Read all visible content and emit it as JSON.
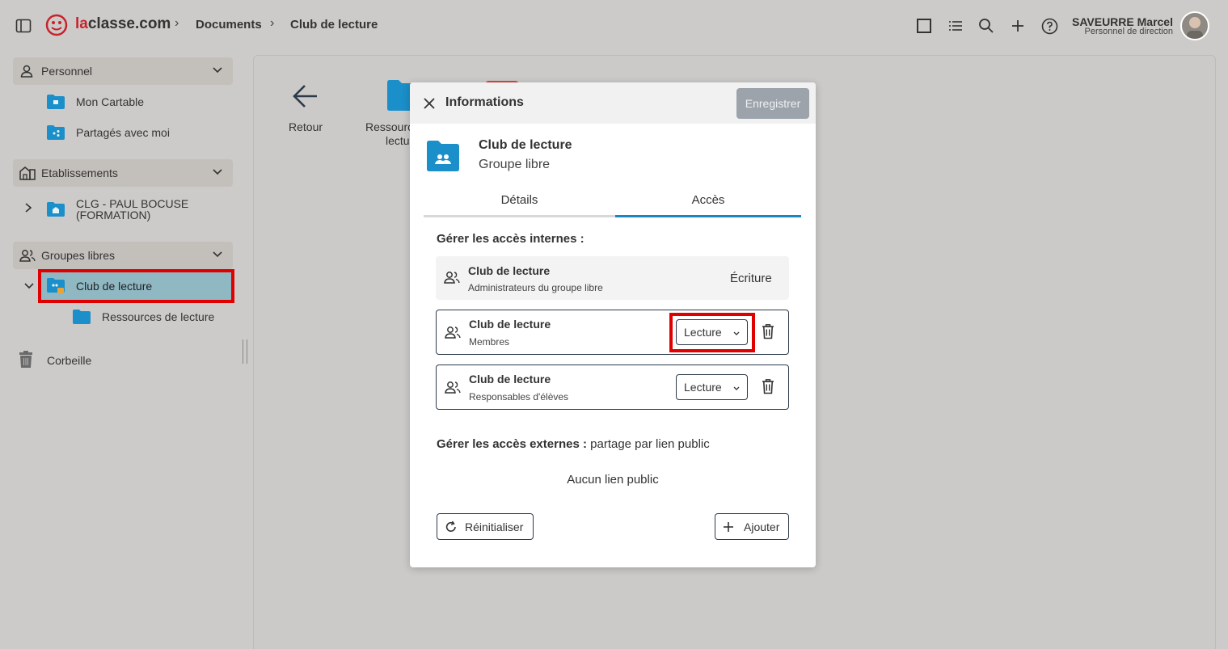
{
  "topbar": {
    "logo_text": "laclasse.com",
    "breadcrumb": [
      "Documents",
      "Club de lecture"
    ],
    "user_name": "SAVEURRE Marcel",
    "user_role": "Personnel de direction"
  },
  "sidebar": {
    "personnel": {
      "label": "Personnel",
      "items": [
        "Mon Cartable",
        "Partagés avec moi"
      ]
    },
    "etablissements": {
      "label": "Etablissements",
      "items": [
        "CLG - PAUL BOCUSE (FORMATION)"
      ]
    },
    "groupes": {
      "label": "Groupes libres",
      "selected": "Club de lecture",
      "child": "Ressources de lecture"
    },
    "trash_label": "Corbeille"
  },
  "content": {
    "back_label": "Retour",
    "folder_label_1": "Ressources",
    "folder_label_2": "lecture"
  },
  "modal": {
    "title": "Informations",
    "save_label": "Enregistrer",
    "item_name": "Club de lecture",
    "item_type": "Groupe libre",
    "tabs": [
      "Détails",
      "Accès"
    ],
    "active_tab": "Accès",
    "internal_heading": "Gérer les accès internes :",
    "rows": [
      {
        "title": "Club de lecture",
        "subtitle": "Administrateurs du groupe libre",
        "access": "Écriture"
      },
      {
        "title": "Club de lecture",
        "subtitle": "Membres",
        "access": "Lecture"
      },
      {
        "title": "Club de lecture",
        "subtitle": "Responsables d'élèves",
        "access": "Lecture"
      }
    ],
    "external_heading_bold": "Gérer les accès externes :",
    "external_heading_rest": " partage par lien public",
    "no_link": "Aucun lien public",
    "reset_label": "Réinitialiser",
    "add_label": "Ajouter"
  },
  "colors": {
    "accent": "#1a86c2",
    "folder": "#1a8fc9",
    "highlight": "#e00000",
    "selected_bg": "#8fb8c3"
  }
}
